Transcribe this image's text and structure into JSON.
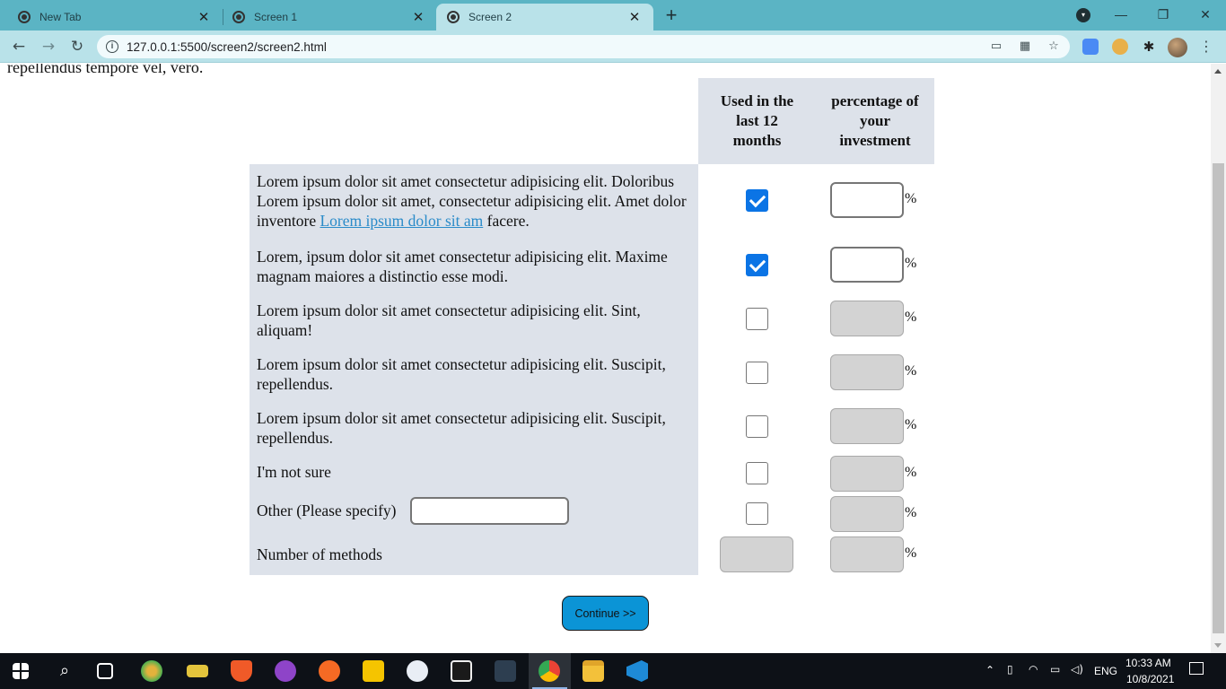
{
  "browser": {
    "tabs": [
      {
        "title": "New Tab",
        "close": "✕"
      },
      {
        "title": "Screen 1",
        "close": "✕"
      },
      {
        "title": "Screen 2",
        "close": "✕"
      }
    ],
    "new_tab": "+",
    "url": "127.0.0.1:5500/screen2/screen2.html",
    "window_controls": {
      "minimize": "—",
      "restore": "❐",
      "close": "✕"
    },
    "nav": {
      "back": "←",
      "forward": "→",
      "reload": "↻"
    }
  },
  "page": {
    "cut_text": "repellendus tempore vel, vero.",
    "headers": {
      "used": "Used in the last 12 months",
      "percentage": "percentage of your investment"
    },
    "percent_sign": "%",
    "rows": [
      {
        "text_before_link": "Lorem ipsum dolor sit amet consectetur adipisicing elit. Doloribus Lorem ipsum dolor sit amet, consectetur adipisicing elit. Amet dolor inventore ",
        "link": "Lorem ipsum dolor sit am",
        "text_after_link": " facere.",
        "checked": true,
        "pct_enabled": true,
        "pct_value": ""
      },
      {
        "text": "Lorem, ipsum dolor sit amet consectetur adipisicing elit. Maxime magnam maiores a distinctio esse modi.",
        "checked": true,
        "pct_enabled": true,
        "pct_value": ""
      },
      {
        "text": "Lorem ipsum dolor sit amet consectetur adipisicing elit. Sint, aliquam!",
        "checked": false,
        "pct_enabled": false,
        "pct_value": ""
      },
      {
        "text": "Lorem ipsum dolor sit amet consectetur adipisicing elit. Suscipit, repellendus.",
        "checked": false,
        "pct_enabled": false,
        "pct_value": ""
      },
      {
        "text": "Lorem ipsum dolor sit amet consectetur adipisicing elit. Suscipit, repellendus.",
        "checked": false,
        "pct_enabled": false,
        "pct_value": ""
      },
      {
        "text": "I'm not sure",
        "checked": false,
        "pct_enabled": false,
        "pct_value": ""
      },
      {
        "text": "Other (Please specify)",
        "other_value": "",
        "checked": false,
        "pct_enabled": false,
        "pct_value": ""
      }
    ],
    "methods_label": "Number of methods",
    "methods_value": "",
    "continue_label": "Continue >>"
  },
  "taskbar": {
    "language": "ENG",
    "time": "10:33 AM",
    "date": "10/8/2021"
  }
}
